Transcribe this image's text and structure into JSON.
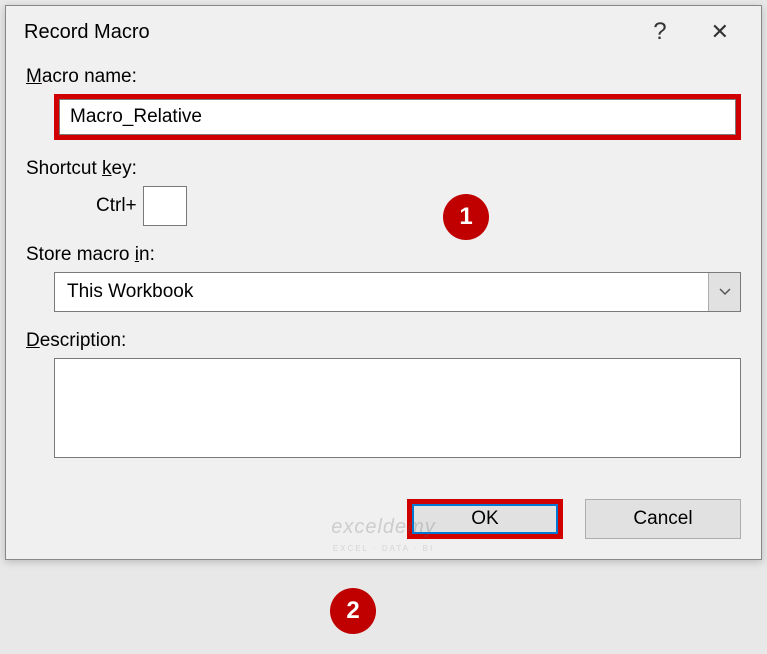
{
  "dialog": {
    "title": "Record Macro",
    "help_symbol": "?",
    "close_symbol": "✕"
  },
  "fields": {
    "macro_name": {
      "label_pre": "",
      "label_mnemonic": "M",
      "label_post": "acro name:",
      "value": "Macro_Relative"
    },
    "shortcut": {
      "label_pre": "Shortcut ",
      "label_mnemonic": "k",
      "label_post": "ey:",
      "prefix": "Ctrl+",
      "value": ""
    },
    "store_in": {
      "label_pre": "Store macro ",
      "label_mnemonic": "i",
      "label_post": "n:",
      "value": "This Workbook"
    },
    "description": {
      "label_pre": "",
      "label_mnemonic": "D",
      "label_post": "escription:",
      "value": ""
    }
  },
  "buttons": {
    "ok": "OK",
    "cancel": "Cancel"
  },
  "callouts": {
    "one": "1",
    "two": "2"
  },
  "watermark": {
    "main": "exceldemy",
    "sub": "EXCEL · DATA · BI"
  }
}
